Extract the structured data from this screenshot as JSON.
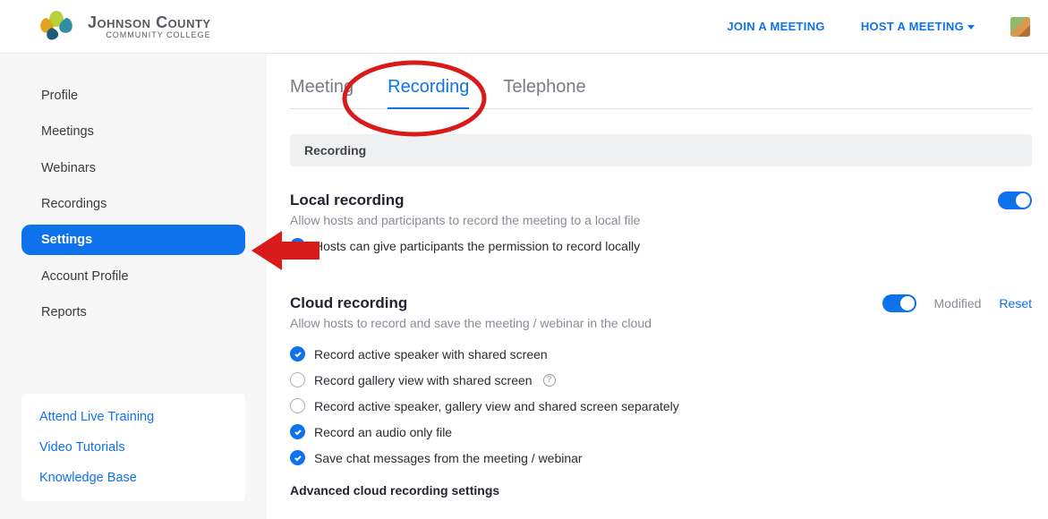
{
  "header": {
    "brand_main": "Johnson County",
    "brand_sub": "COMMUNITY COLLEGE",
    "join_label": "JOIN A MEETING",
    "host_label": "HOST A MEETING"
  },
  "sidebar": {
    "items": [
      {
        "label": "Profile"
      },
      {
        "label": "Meetings"
      },
      {
        "label": "Webinars"
      },
      {
        "label": "Recordings"
      },
      {
        "label": "Settings",
        "active": true
      },
      {
        "label": "Account Profile"
      },
      {
        "label": "Reports"
      }
    ],
    "help": [
      {
        "label": "Attend Live Training"
      },
      {
        "label": "Video Tutorials"
      },
      {
        "label": "Knowledge Base"
      }
    ]
  },
  "tabs": {
    "items": [
      {
        "label": "Meeting"
      },
      {
        "label": "Recording",
        "active": true
      },
      {
        "label": "Telephone"
      }
    ],
    "section_header": "Recording"
  },
  "local": {
    "title": "Local recording",
    "desc": "Allow hosts and participants to record the meeting to a local file",
    "toggle_on": true,
    "opt1": {
      "label": "Hosts can give participants the permission to record locally",
      "checked": true
    }
  },
  "cloud": {
    "title": "Cloud recording",
    "desc": "Allow hosts to record and save the meeting / webinar in the cloud",
    "toggle_on": true,
    "modified": "Modified",
    "reset": "Reset",
    "opts": [
      {
        "label": "Record active speaker with shared screen",
        "checked": true
      },
      {
        "label": "Record gallery view with shared screen",
        "checked": false,
        "info": true
      },
      {
        "label": "Record active speaker, gallery view and shared screen separately",
        "checked": false
      },
      {
        "label": "Record an audio only file",
        "checked": true
      },
      {
        "label": "Save chat messages from the meeting / webinar",
        "checked": true
      }
    ],
    "advanced": "Advanced cloud recording settings"
  },
  "annotation": {
    "ellipse_color": "#d91a1a",
    "arrow_color": "#d91a1a"
  }
}
